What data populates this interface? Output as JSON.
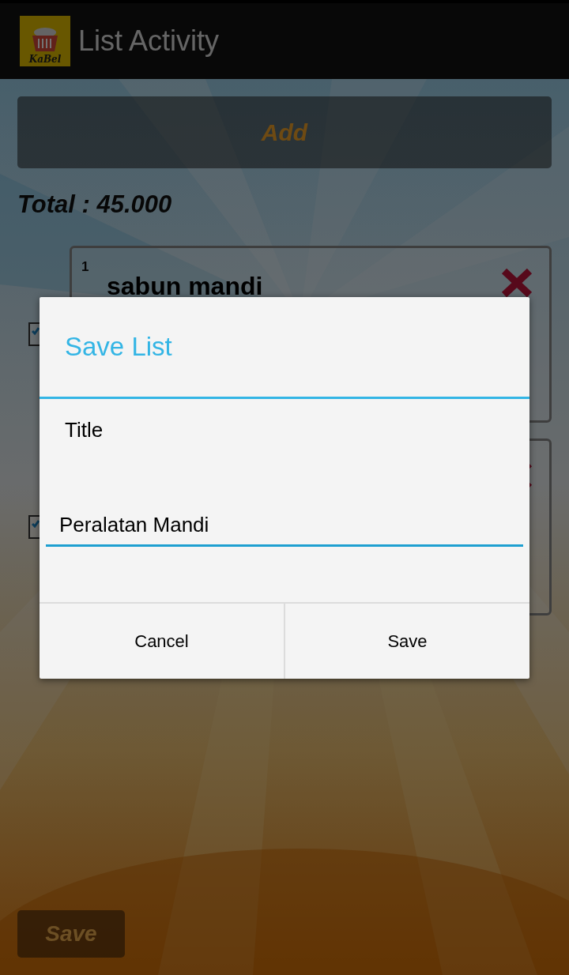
{
  "app_bar": {
    "logo_text": "KaBel",
    "title": "List Activity"
  },
  "add_button": "Add",
  "total": "Total : 45.000",
  "items": [
    {
      "number": "1",
      "name": "sabun mandi",
      "checked": true
    },
    {
      "checked": true
    }
  ],
  "save_button": "Save",
  "dialog": {
    "title": "Save List",
    "field_label": "Title",
    "field_value": "Peralatan Mandi",
    "buttons": [
      "Cancel",
      "Save"
    ]
  }
}
